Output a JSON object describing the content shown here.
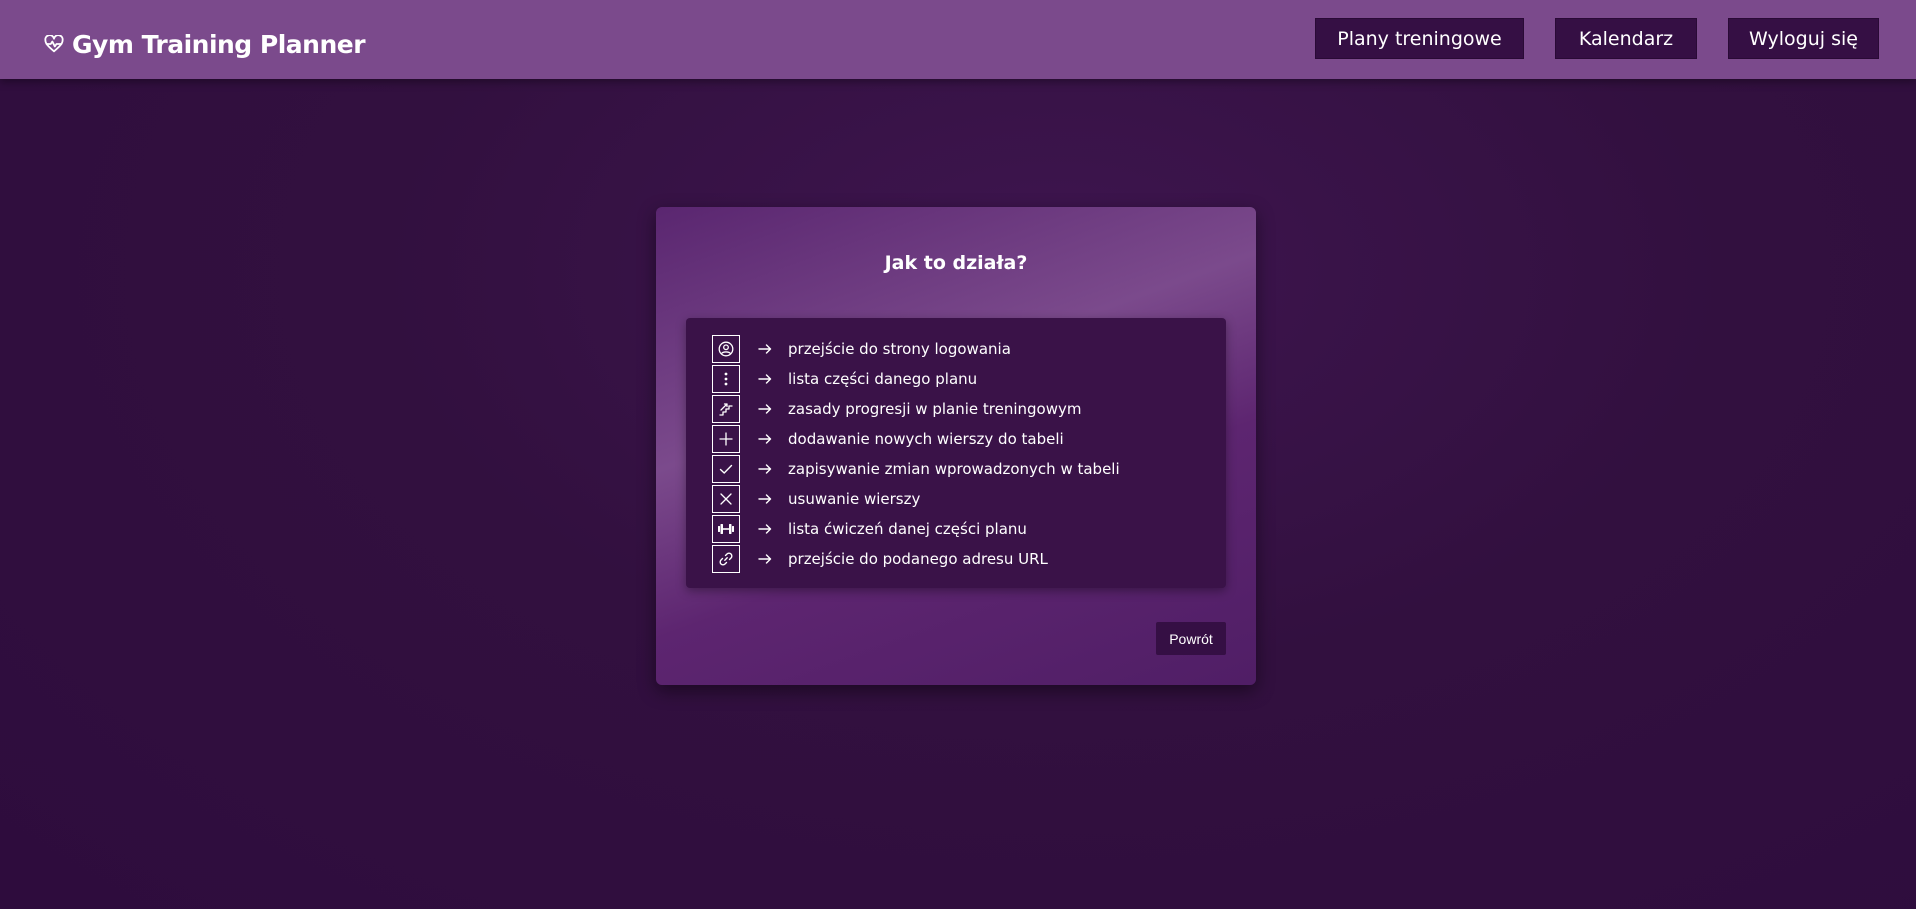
{
  "app": {
    "title": "Gym Training Planner",
    "brand_icon": "heart-pulse-icon"
  },
  "navbar": {
    "items": [
      {
        "label": "Plany treningowe"
      },
      {
        "label": "Kalendarz"
      },
      {
        "label": "Wyloguj się"
      }
    ]
  },
  "help": {
    "title": "Jak to działa?",
    "legend": [
      {
        "icon": "user-circle-icon",
        "text": "przejście do strony logowania"
      },
      {
        "icon": "vertical-dots-icon",
        "text": "lista części danego planu"
      },
      {
        "icon": "progression-stairs-icon",
        "text": "zasady progresji w planie treningowym"
      },
      {
        "icon": "plus-icon",
        "text": "dodawanie nowych wierszy do tabeli"
      },
      {
        "icon": "check-icon",
        "text": "zapisywanie zmian wprowadzonych w tabeli"
      },
      {
        "icon": "x-icon",
        "text": "usuwanie wierszy"
      },
      {
        "icon": "dumbbell-icon",
        "text": "lista ćwiczeń danej części planu"
      },
      {
        "icon": "link-icon",
        "text": "przejście do podanego adresu URL"
      }
    ],
    "back_label": "Powrót"
  },
  "colors": {
    "navbar": "#7b4a8c",
    "background": "#32103f",
    "button": "#350f44",
    "legend_panel": "#3a1248"
  }
}
